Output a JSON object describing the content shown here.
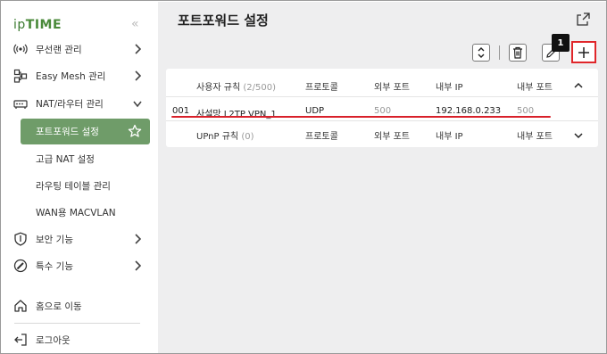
{
  "sidebar": {
    "logo_ip": "ip",
    "logo_time": "TIME",
    "collapse_glyph": "«",
    "items": [
      {
        "label": "무선랜 관리",
        "icon": "wifi-icon"
      },
      {
        "label": "Easy Mesh 관리",
        "icon": "mesh-icon"
      },
      {
        "label": "NAT/라우터 관리",
        "icon": "router-icon"
      }
    ],
    "sub_items": [
      "포트포워드 설정",
      "고급 NAT 설정",
      "라우팅 테이블 관리",
      "WAN용 MACVLAN"
    ],
    "more_items": [
      {
        "label": "보안 기능",
        "icon": "shield-icon"
      },
      {
        "label": "특수 기능",
        "icon": "tools-icon"
      }
    ],
    "home": "홈으로 이동",
    "logout": "로그아웃"
  },
  "main": {
    "title": "포트포워드 설정",
    "badge": "1",
    "table": {
      "header": {
        "rule_label": "사용자 규칙",
        "rule_count": "(2/500)",
        "protocol": "프로토콜",
        "external_port": "외부 포트",
        "internal_ip": "내부 IP",
        "internal_port": "내부 포트"
      },
      "rows": [
        {
          "index": "001",
          "name": "사설망 L2TP VPN_1",
          "protocol": "UDP",
          "external_port": "500",
          "internal_ip": "192.168.0.233",
          "internal_port": "500"
        }
      ],
      "upnp": {
        "label": "UPnP 규칙",
        "count": "(0)",
        "protocol": "프로토콜",
        "external_port": "외부 포트",
        "internal_ip": "내부 IP",
        "internal_port": "내부 포트"
      }
    }
  },
  "colors": {
    "accent": "#6f9c69",
    "highlight": "#e0262a",
    "logo": "#4a8a3a"
  }
}
